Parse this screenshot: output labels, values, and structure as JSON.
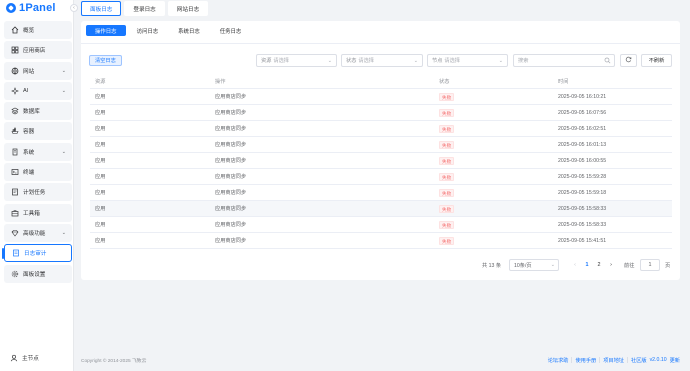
{
  "app": {
    "logo_text": "1Panel"
  },
  "sidebar": {
    "items": [
      {
        "label": "概览",
        "icon": "home-icon",
        "arrow": false
      },
      {
        "label": "应用商店",
        "icon": "store-icon",
        "arrow": false
      },
      {
        "label": "网站",
        "icon": "globe-icon",
        "arrow": true
      },
      {
        "label": "AI",
        "icon": "ai-icon",
        "arrow": true
      },
      {
        "label": "数据库",
        "icon": "database-icon",
        "arrow": false
      },
      {
        "label": "容器",
        "icon": "container-icon",
        "arrow": false
      },
      {
        "label": "系统",
        "icon": "system-icon",
        "arrow": true
      },
      {
        "label": "终端",
        "icon": "terminal-icon",
        "arrow": false
      },
      {
        "label": "计划任务",
        "icon": "cron-icon",
        "arrow": false
      },
      {
        "label": "工具箱",
        "icon": "toolbox-icon",
        "arrow": false
      },
      {
        "label": "高级功能",
        "icon": "diamond-icon",
        "arrow": true
      },
      {
        "label": "日志审计",
        "icon": "log-icon",
        "arrow": false,
        "active": true
      },
      {
        "label": "面板设置",
        "icon": "gear-icon",
        "arrow": false
      }
    ],
    "node_label": "主节点"
  },
  "top_tabs": [
    "面板日志",
    "登录日志",
    "网站日志"
  ],
  "sub_tabs": [
    "操作日志",
    "访问日志",
    "系统日志",
    "任务日志"
  ],
  "toolbar": {
    "clear_label": "清空日志",
    "filters": [
      {
        "label": "资源",
        "placeholder": "请选择"
      },
      {
        "label": "状态",
        "placeholder": "请选择"
      },
      {
        "label": "节点",
        "placeholder": "请选择"
      }
    ],
    "search_placeholder": "搜索",
    "norefresh_label": "不刷新"
  },
  "table": {
    "headers": [
      "资源",
      "操作",
      "状态",
      "时间"
    ],
    "rows": [
      {
        "resource": "应用",
        "action": "应用商店同步",
        "status": "失败",
        "time": "2025-09-05 16:10:21"
      },
      {
        "resource": "应用",
        "action": "应用商店同步",
        "status": "失败",
        "time": "2025-09-05 16:07:56"
      },
      {
        "resource": "应用",
        "action": "应用商店同步",
        "status": "失败",
        "time": "2025-09-05 16:02:51"
      },
      {
        "resource": "应用",
        "action": "应用商店同步",
        "status": "失败",
        "time": "2025-09-05 16:01:13"
      },
      {
        "resource": "应用",
        "action": "应用商店同步",
        "status": "失败",
        "time": "2025-09-05 16:00:55"
      },
      {
        "resource": "应用",
        "action": "应用商店同步",
        "status": "失败",
        "time": "2025-09-05 15:59:28"
      },
      {
        "resource": "应用",
        "action": "应用商店同步",
        "status": "失败",
        "time": "2025-09-05 15:59:18"
      },
      {
        "resource": "应用",
        "action": "应用商店同步",
        "status": "失败",
        "time": "2025-09-05 15:58:33"
      },
      {
        "resource": "应用",
        "action": "应用商店同步",
        "status": "失败",
        "time": "2025-09-05 15:58:33"
      },
      {
        "resource": "应用",
        "action": "应用商店同步",
        "status": "失败",
        "time": "2025-09-05 15:41:51"
      }
    ]
  },
  "pagination": {
    "total_text": "共 13 条",
    "page_size": "10条/页",
    "pages": [
      "1",
      "2"
    ],
    "current_page": "1",
    "goto_label": "前往",
    "goto_value": "1",
    "page_unit": "页"
  },
  "footer": {
    "copyright": "Copyright © 2014-2025 飞致云",
    "links": [
      "论坛求助",
      "使用手册",
      "项目地址",
      "社区版"
    ],
    "version": "v2.0.10",
    "update": "更新"
  },
  "colors": {
    "accent": "#1677ff",
    "danger": "#f56c6c",
    "bg": "#f1f3f6"
  }
}
